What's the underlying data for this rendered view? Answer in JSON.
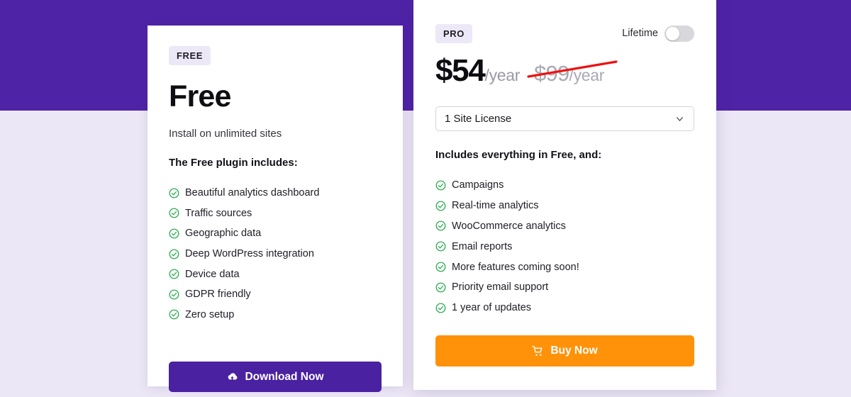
{
  "theme": {
    "band_purple": "#4F23A6",
    "page_background": "#ECE7F6",
    "badge_background": "#EDE8F8",
    "check_green": "#18A642",
    "strike_red": "#EE1111",
    "download_button_color": "#4A21A0",
    "buy_button_color": "#FF9209",
    "muted_text": "#9A9AA6"
  },
  "free_plan": {
    "badge": "FREE",
    "title": "Free",
    "subtitle": "Install on unlimited sites",
    "includes_heading": "The Free plugin includes:",
    "features": [
      "Beautiful analytics dashboard",
      "Traffic sources",
      "Geographic data",
      "Deep WordPress integration",
      "Device data",
      "GDPR friendly",
      "Zero setup"
    ],
    "cta": {
      "label": "Download Now",
      "icon": "cloud-download-icon"
    }
  },
  "pro_plan": {
    "badge": "PRO",
    "lifetime_toggle": {
      "label": "Lifetime",
      "state": "off"
    },
    "price": {
      "current_amount": "$54",
      "current_period": "/year",
      "original_amount": "$99",
      "original_period": "/year",
      "strikethrough": true
    },
    "license_select": {
      "value": "1 Site License",
      "chevron": "chevron-down-icon"
    },
    "includes_heading": "Includes everything in Free, and:",
    "features": [
      "Campaigns",
      "Real-time analytics",
      "WooCommerce analytics",
      "Email reports",
      "More features coming soon!",
      "Priority email support",
      "1 year of updates"
    ],
    "cta": {
      "label": "Buy Now",
      "icon": "shopping-cart-icon"
    }
  }
}
